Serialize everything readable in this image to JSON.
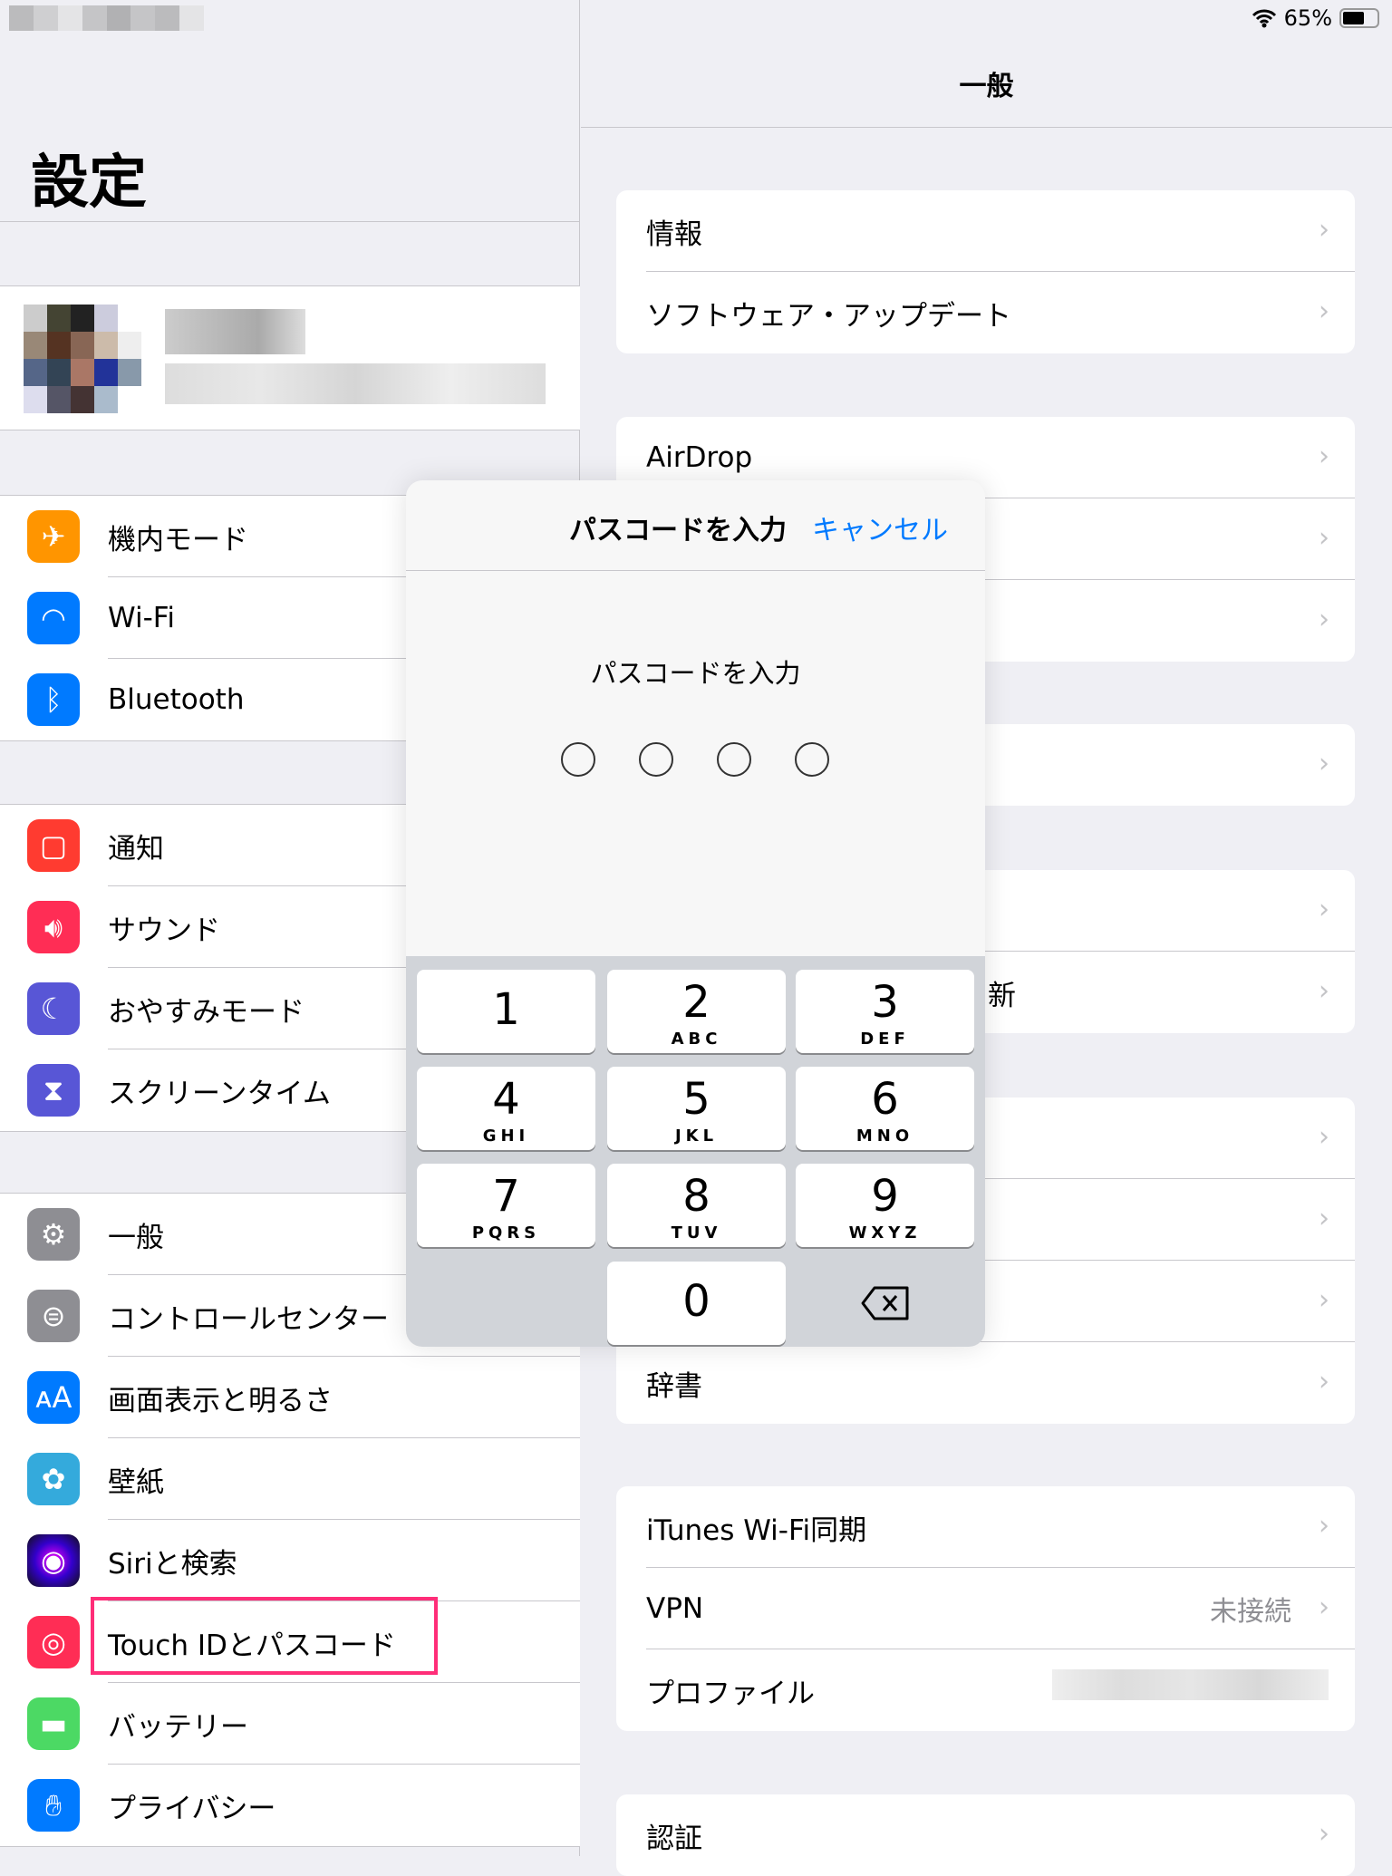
{
  "status": {
    "battery_percent": "65%",
    "battery_level": 0.65,
    "wifi_icon": "wifi-icon"
  },
  "left": {
    "title": "設定",
    "group1": [
      {
        "label": "機内モード",
        "color": "#ff9500",
        "icon": "airplane-icon"
      },
      {
        "label": "Wi-Fi",
        "color": "#007aff",
        "icon": "wifi-icon"
      },
      {
        "label": "Bluetooth",
        "color": "#007aff",
        "icon": "bluetooth-icon"
      }
    ],
    "group2": [
      {
        "label": "通知",
        "color": "#ff3b30",
        "icon": "notification-icon"
      },
      {
        "label": "サウンド",
        "color": "#ff2d55",
        "icon": "speaker-icon"
      },
      {
        "label": "おやすみモード",
        "color": "#5856d6",
        "icon": "moon-icon"
      },
      {
        "label": "スクリーンタイム",
        "color": "#5856d6",
        "icon": "hourglass-icon"
      }
    ],
    "group3": [
      {
        "label": "一般",
        "color": "#8e8e93",
        "icon": "gear-icon"
      },
      {
        "label": "コントロールセンター",
        "color": "#8e8e93",
        "icon": "toggle-icon"
      },
      {
        "label": "画面表示と明るさ",
        "color": "#007aff",
        "icon": "text-size-icon"
      },
      {
        "label": "壁紙",
        "color": "#34aadc",
        "icon": "flower-icon"
      },
      {
        "label": "Siriと検索",
        "color": "#222244",
        "icon": "siri-icon"
      },
      {
        "label": "Touch IDとパスコード",
        "color": "#ff2d55",
        "icon": "fingerprint-icon"
      },
      {
        "label": "バッテリー",
        "color": "#4cd964",
        "icon": "battery-icon"
      },
      {
        "label": "プライバシー",
        "color": "#007aff",
        "icon": "hand-icon"
      }
    ],
    "highlight_color": "#ff2d78"
  },
  "right": {
    "title": "一般",
    "card1": [
      "情報",
      "ソフトウェア・アップデート"
    ],
    "card2": [
      "AirDrop",
      "",
      ""
    ],
    "card3": [
      ""
    ],
    "card4": [
      "",
      "新"
    ],
    "card5": [
      "",
      "",
      "",
      "辞書"
    ],
    "card6": [
      {
        "label": "iTunes Wi-Fi同期",
        "value": ""
      },
      {
        "label": "VPN",
        "value": "未接続"
      },
      {
        "label": "プロファイル",
        "value": ""
      }
    ],
    "card7": [
      "認証"
    ]
  },
  "modal": {
    "title": "パスコードを入力",
    "cancel": "キャンセル",
    "prompt": "パスコードを入力",
    "accent": "#007aff",
    "keys": [
      {
        "n": "1",
        "l": ""
      },
      {
        "n": "2",
        "l": "ABC"
      },
      {
        "n": "3",
        "l": "DEF"
      },
      {
        "n": "4",
        "l": "GHI"
      },
      {
        "n": "5",
        "l": "JKL"
      },
      {
        "n": "6",
        "l": "MNO"
      },
      {
        "n": "7",
        "l": "PQRS"
      },
      {
        "n": "8",
        "l": "TUV"
      },
      {
        "n": "9",
        "l": "WXYZ"
      },
      {
        "n": "0",
        "l": ""
      }
    ],
    "delete_icon": "delete-backspace-icon"
  }
}
